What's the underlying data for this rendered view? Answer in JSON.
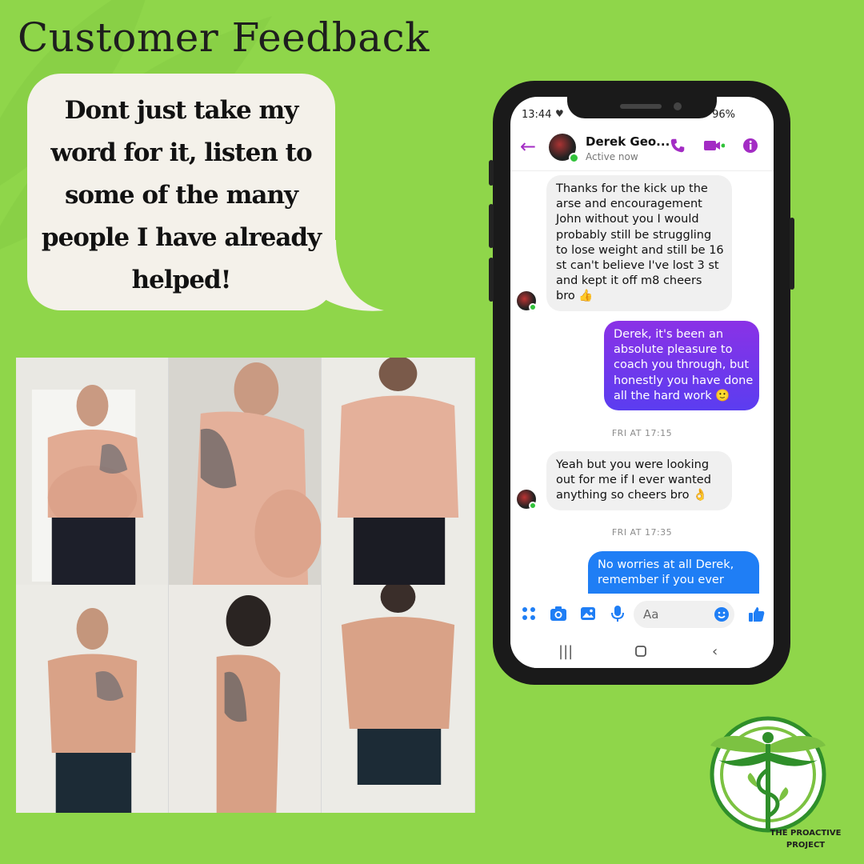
{
  "page": {
    "title": "Customer Feedback",
    "quote_lines": [
      "Dont just take my",
      "word for it, listen to",
      "some of the many",
      "people I have already",
      "helped!"
    ],
    "background_color": "#8fd64a"
  },
  "photos": {
    "before": [
      "before-front",
      "before-side",
      "before-back"
    ],
    "after": [
      "after-front",
      "after-side",
      "after-back"
    ]
  },
  "phone": {
    "status": {
      "time": "13:44",
      "battery": "96%"
    },
    "header": {
      "name": "Derek Geo...",
      "status": "Active now",
      "accent": "#a32cc4"
    },
    "messages": [
      {
        "from": "contact",
        "lines": [
          "Thanks for the kick up the",
          "arse and encouragement",
          "John without you I would",
          "probably still be struggling",
          "to lose weight and still be 16",
          "st can't believe I've lost 3 st",
          "and kept it off    m8 cheers",
          "bro 👍"
        ]
      },
      {
        "from": "me",
        "lines": [
          "Derek, it's been an",
          "absolute pleasure to",
          "coach you through, but",
          "honestly you have done",
          "all the hard work 🙂"
        ]
      },
      {
        "timestamp": "FRI AT 17:15"
      },
      {
        "from": "contact",
        "lines": [
          "Yeah but you were looking",
          "out for me if I ever wanted",
          "anything so cheers bro 👌"
        ]
      },
      {
        "timestamp": "FRI AT 17:35"
      },
      {
        "from": "me",
        "lines": [
          "No worries at all Derek,",
          "remember if you ever"
        ]
      }
    ],
    "composer": {
      "placeholder": "Aa"
    }
  },
  "logo": {
    "line1": "THE PROACTIVE",
    "line2": "PROJECT",
    "color": "#2f8f2a"
  }
}
